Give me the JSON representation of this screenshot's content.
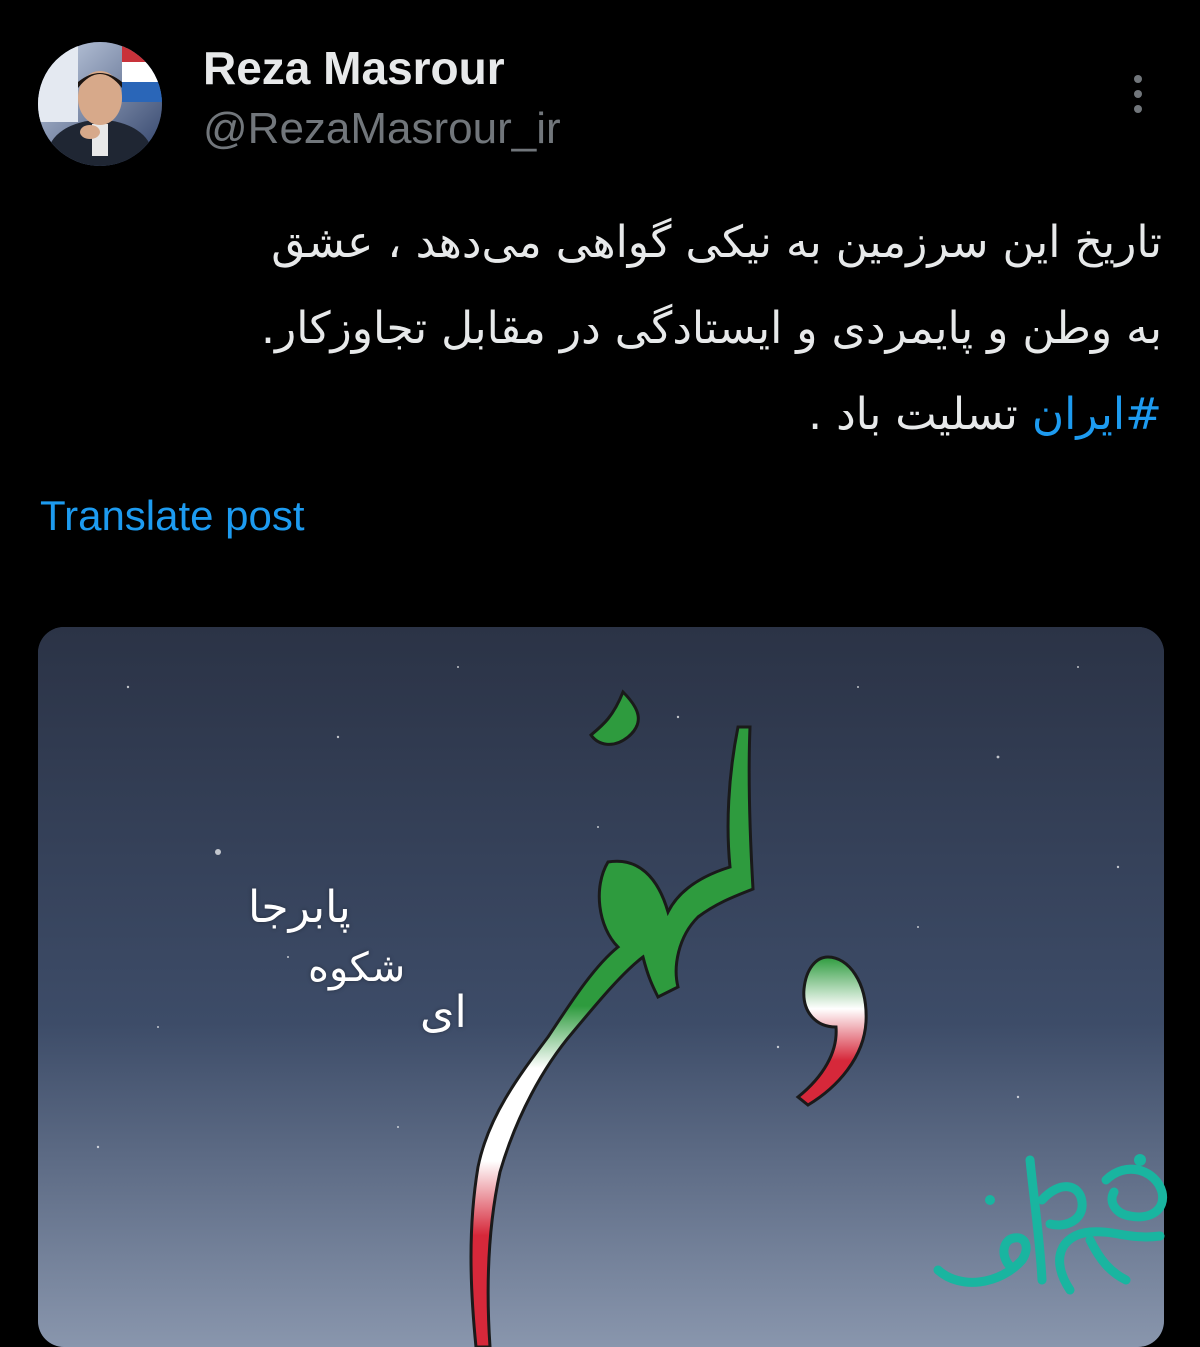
{
  "author": {
    "display_name": "Reza Masrour",
    "handle": "@RezaMasrour_ir"
  },
  "post": {
    "lines": [
      "تاریخ این سرزمین  به نیکی گواهی می‌دهد  ، عشق",
      "به وطن  و پایمردی و ایستادگی در مقابل تجاوزکار."
    ],
    "hashtag": "#ایران",
    "last_line_rest": " تسلیت باد ."
  },
  "translate_label": "Translate post",
  "media": {
    "poem_lines": [
      "پابرجا",
      "شکوه",
      "ای"
    ],
    "flag_colors": {
      "green": "#2e9b3e",
      "white": "#ffffff",
      "red": "#d6283a"
    },
    "watermark_color": "#19b5a0"
  },
  "icons": {
    "more": "more-vertical-icon"
  }
}
